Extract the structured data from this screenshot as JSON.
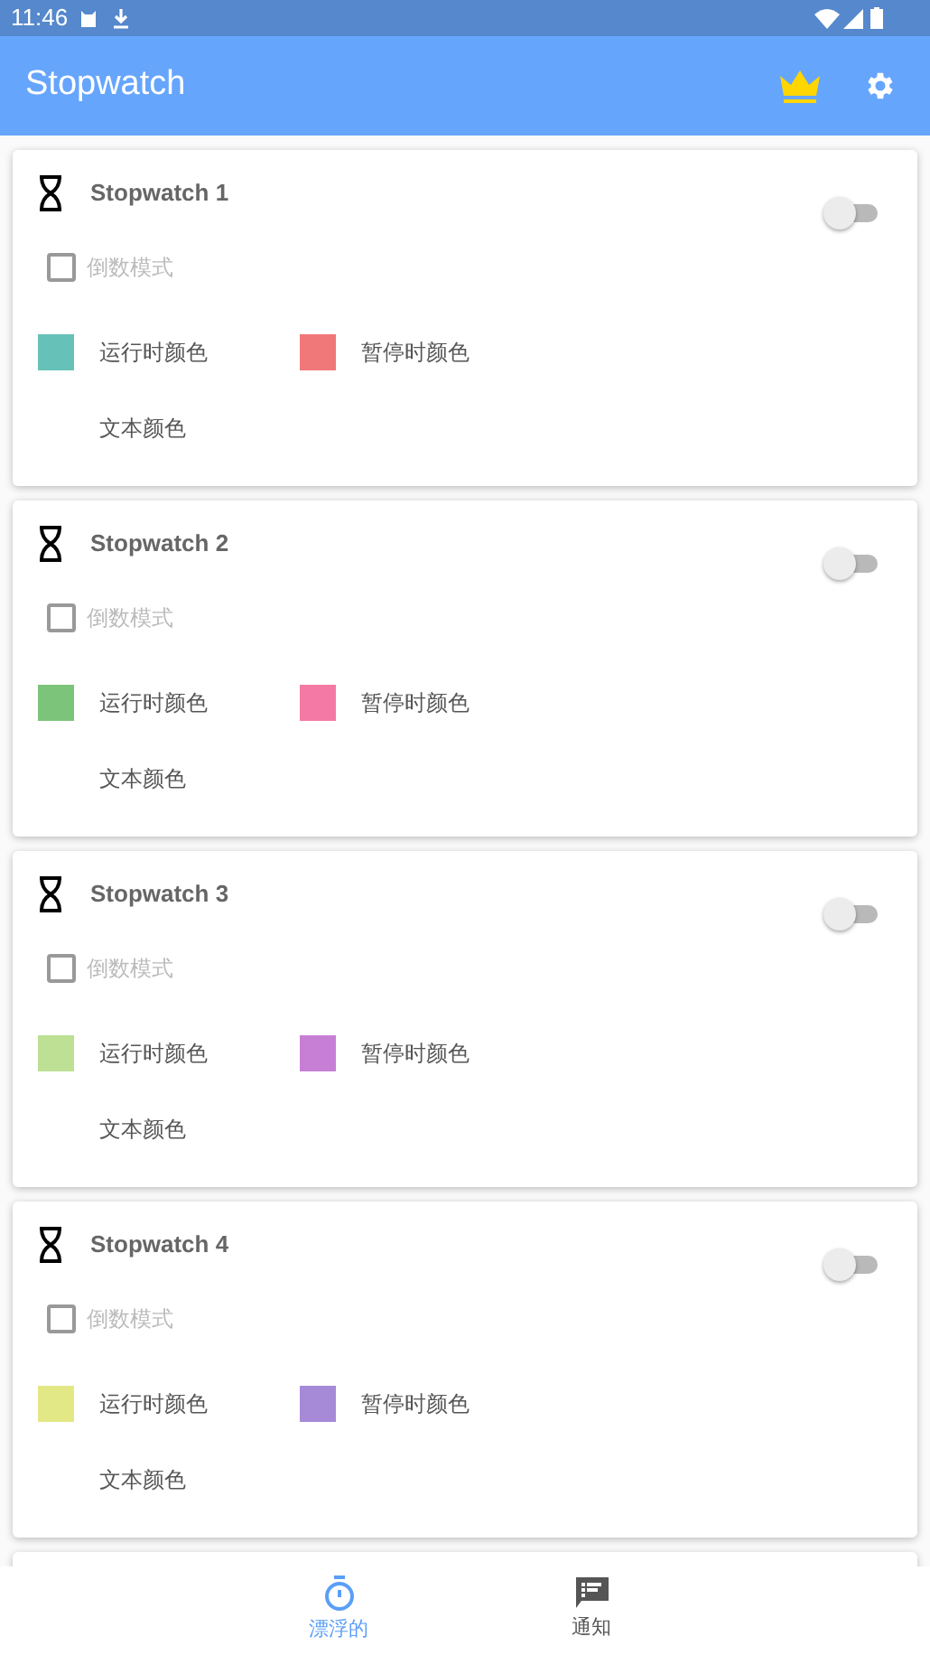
{
  "status_bar": {
    "time": "11:46"
  },
  "app_bar": {
    "title": "Stopwatch"
  },
  "cards": [
    {
      "title": "Stopwatch 1",
      "on": false,
      "countdown": {
        "label": "倒数模式",
        "checked": false
      },
      "running": {
        "label": "运行时颜色",
        "color": "#66c2b8"
      },
      "paused": {
        "label": "暂停时颜色",
        "color": "#f07878"
      },
      "text_color": {
        "label": "文本颜色"
      }
    },
    {
      "title": "Stopwatch 2",
      "on": false,
      "countdown": {
        "label": "倒数模式",
        "checked": false
      },
      "running": {
        "label": "运行时颜色",
        "color": "#7cc47a"
      },
      "paused": {
        "label": "暂停时颜色",
        "color": "#f47aa5"
      },
      "text_color": {
        "label": "文本颜色"
      }
    },
    {
      "title": "Stopwatch 3",
      "on": false,
      "countdown": {
        "label": "倒数模式",
        "checked": false
      },
      "running": {
        "label": "运行时颜色",
        "color": "#bde095"
      },
      "paused": {
        "label": "暂停时颜色",
        "color": "#c77fd6"
      },
      "text_color": {
        "label": "文本颜色"
      }
    },
    {
      "title": "Stopwatch 4",
      "on": false,
      "countdown": {
        "label": "倒数模式",
        "checked": false
      },
      "running": {
        "label": "运行时颜色",
        "color": "#e3e887"
      },
      "paused": {
        "label": "暂停时颜色",
        "color": "#a68ad8"
      },
      "text_color": {
        "label": "文本颜色"
      }
    }
  ],
  "bottom_nav": [
    {
      "label": "漂浮的",
      "kind": "timer",
      "selected": true
    },
    {
      "label": "通知",
      "kind": "message",
      "selected": false
    }
  ]
}
